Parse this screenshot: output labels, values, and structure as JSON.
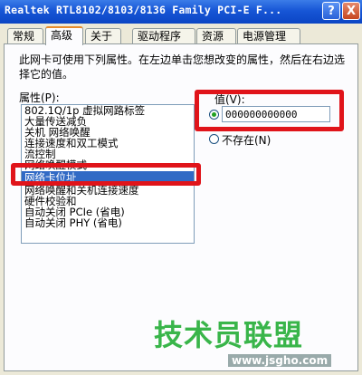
{
  "window": {
    "title": "Realtek RTL8102/8103/8136 Family PCI-E F...",
    "help_label": "?",
    "close_label": "X"
  },
  "tabs": [
    {
      "label": "常规"
    },
    {
      "label": "高级",
      "active": true
    },
    {
      "label": "关于"
    },
    {
      "label": "驱动程序"
    },
    {
      "label": "资源"
    },
    {
      "label": "电源管理"
    }
  ],
  "advanced": {
    "description": "此网卡可使用下列属性。在左边单击您想改变的属性，然后在右边选择它的值。",
    "property_label": "属性(P):",
    "properties": [
      "802.1Q/1p 虚拟网路标签",
      "大量传送减负",
      "关机 网络唤醒",
      "连接速度和双工模式",
      "流控制",
      "网络唤醒模式",
      "网络卡位址",
      "网络唤醒和关机连接速度",
      "硬件校验和",
      "自动关闭 PCIe (省电)",
      "自动关闭 PHY (省电)"
    ],
    "selected_index": 6,
    "value_label": "值(V):",
    "value": "000000000000",
    "not_present_label": "不存在(N)"
  },
  "watermark": {
    "text": "技术员联盟",
    "url": "www.jsgho.com"
  },
  "colors": {
    "highlight_red": "#e0141a",
    "selection_blue": "#316ac5",
    "titlebar_blue": "#0b45c4"
  }
}
